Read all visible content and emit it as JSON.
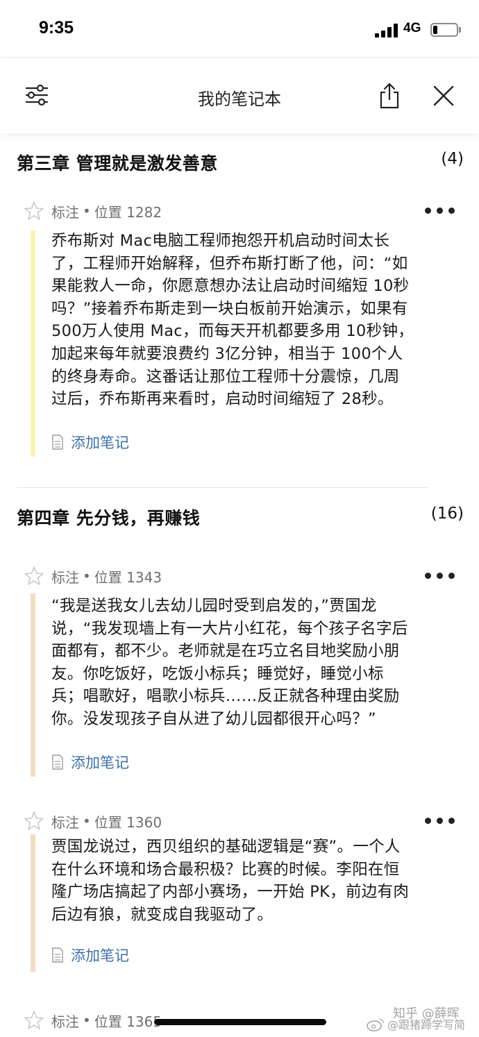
{
  "status": {
    "time": "9:35",
    "network": "4G",
    "battery_level": 0.2
  },
  "header": {
    "title": "我的笔记本",
    "icons": [
      "sliders-icon",
      "share-icon",
      "close-icon"
    ]
  },
  "chapters": [
    {
      "title": "第三章  管理就是激发善意",
      "count": "(4)",
      "notes": [
        {
          "type": "标注",
          "location": "位置 1282",
          "highlight_color": "#fbf3b5",
          "lines": [
            "乔布斯对 Mac电脑工程师抱怨开机启动时间太长",
            "了，工程师开始解释，但乔布斯打断了他，问：“如",
            "果能救人一命，你愿意想办法让启动时间缩短 10秒",
            "吗？”接着乔布斯走到一块白板前开始演示，如果有",
            "500万人使用 Mac，而每天开机都要多用 10秒钟，",
            "加起来每年就要浪费约 3亿分钟，相当于 100个人",
            "的终身寿命。这番话让那位工程师十分震惊，几周",
            "过后，乔布斯再来看时，启动时间缩短了 28秒。"
          ],
          "add_note_label": "添加笔记"
        }
      ]
    },
    {
      "title": "第四章  先分钱，再赚钱",
      "count": "(16)",
      "notes": [
        {
          "type": "标注",
          "location": "位置 1343",
          "highlight_color": "#f4dcbf",
          "lines": [
            "“我是送我女儿去幼儿园时受到启发的，”贾国龙",
            "说，“我发现墙上有一大片小红花，每个孩子名字后",
            "面都有，都不少。老师就是在巧立名目地奖励小朋",
            "友。你吃饭好，吃饭小标兵；睡觉好，睡觉小标",
            "兵；唱歌好，唱歌小标兵……反正就各种理由奖励",
            "你。没发现孩子自从进了幼儿园都很开心吗？”"
          ],
          "add_note_label": "添加笔记"
        },
        {
          "type": "标注",
          "location": "位置 1360",
          "highlight_color": "#f4dcbf",
          "lines": [
            "贾国龙说过，西贝组织的基础逻辑是“赛”。一个人",
            "在什么环境和场合最积极？比赛的时候。李阳在恒",
            "隆广场店搞起了内部小赛场，一开始 PK，前边有肉",
            "后边有狼，就变成自我驱动了。"
          ],
          "add_note_label": "添加笔记"
        },
        {
          "type": "标注",
          "location": "位置 1365",
          "highlight_color": "#f4dcbf",
          "lines": [],
          "add_note_label": ""
        }
      ]
    }
  ],
  "watermark": {
    "line1": "知乎 @薛晖",
    "line2": "@跟猪蹄学写简"
  }
}
